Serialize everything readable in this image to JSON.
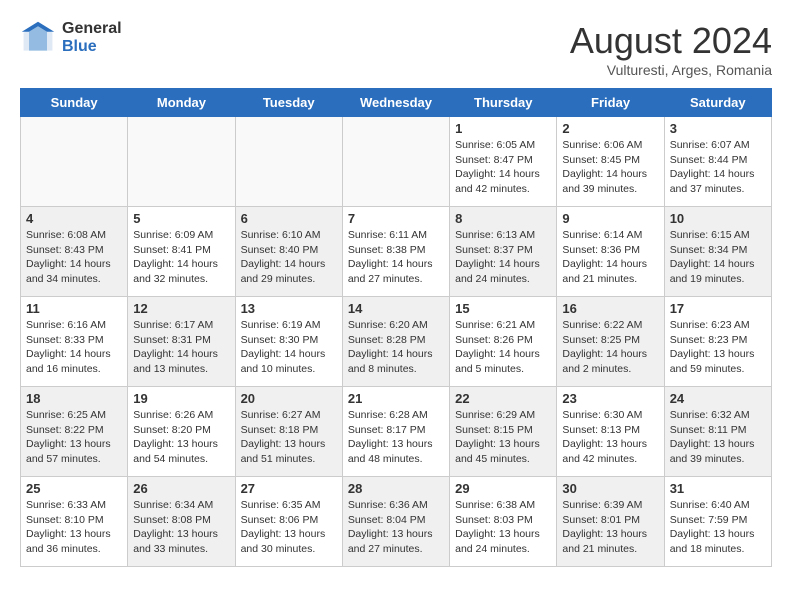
{
  "header": {
    "logo_general": "General",
    "logo_blue": "Blue",
    "month_title": "August 2024",
    "subtitle": "Vulturesti, Arges, Romania"
  },
  "days_of_week": [
    "Sunday",
    "Monday",
    "Tuesday",
    "Wednesday",
    "Thursday",
    "Friday",
    "Saturday"
  ],
  "weeks": [
    [
      {
        "day": "",
        "empty": true
      },
      {
        "day": "",
        "empty": true
      },
      {
        "day": "",
        "empty": true
      },
      {
        "day": "",
        "empty": true
      },
      {
        "day": "1",
        "info": "Sunrise: 6:05 AM\nSunset: 8:47 PM\nDaylight: 14 hours\nand 42 minutes."
      },
      {
        "day": "2",
        "info": "Sunrise: 6:06 AM\nSunset: 8:45 PM\nDaylight: 14 hours\nand 39 minutes."
      },
      {
        "day": "3",
        "info": "Sunrise: 6:07 AM\nSunset: 8:44 PM\nDaylight: 14 hours\nand 37 minutes."
      }
    ],
    [
      {
        "day": "4",
        "info": "Sunrise: 6:08 AM\nSunset: 8:43 PM\nDaylight: 14 hours\nand 34 minutes.",
        "shaded": true
      },
      {
        "day": "5",
        "info": "Sunrise: 6:09 AM\nSunset: 8:41 PM\nDaylight: 14 hours\nand 32 minutes."
      },
      {
        "day": "6",
        "info": "Sunrise: 6:10 AM\nSunset: 8:40 PM\nDaylight: 14 hours\nand 29 minutes.",
        "shaded": true
      },
      {
        "day": "7",
        "info": "Sunrise: 6:11 AM\nSunset: 8:38 PM\nDaylight: 14 hours\nand 27 minutes."
      },
      {
        "day": "8",
        "info": "Sunrise: 6:13 AM\nSunset: 8:37 PM\nDaylight: 14 hours\nand 24 minutes.",
        "shaded": true
      },
      {
        "day": "9",
        "info": "Sunrise: 6:14 AM\nSunset: 8:36 PM\nDaylight: 14 hours\nand 21 minutes."
      },
      {
        "day": "10",
        "info": "Sunrise: 6:15 AM\nSunset: 8:34 PM\nDaylight: 14 hours\nand 19 minutes.",
        "shaded": true
      }
    ],
    [
      {
        "day": "11",
        "info": "Sunrise: 6:16 AM\nSunset: 8:33 PM\nDaylight: 14 hours\nand 16 minutes."
      },
      {
        "day": "12",
        "info": "Sunrise: 6:17 AM\nSunset: 8:31 PM\nDaylight: 14 hours\nand 13 minutes.",
        "shaded": true
      },
      {
        "day": "13",
        "info": "Sunrise: 6:19 AM\nSunset: 8:30 PM\nDaylight: 14 hours\nand 10 minutes."
      },
      {
        "day": "14",
        "info": "Sunrise: 6:20 AM\nSunset: 8:28 PM\nDaylight: 14 hours\nand 8 minutes.",
        "shaded": true
      },
      {
        "day": "15",
        "info": "Sunrise: 6:21 AM\nSunset: 8:26 PM\nDaylight: 14 hours\nand 5 minutes."
      },
      {
        "day": "16",
        "info": "Sunrise: 6:22 AM\nSunset: 8:25 PM\nDaylight: 14 hours\nand 2 minutes.",
        "shaded": true
      },
      {
        "day": "17",
        "info": "Sunrise: 6:23 AM\nSunset: 8:23 PM\nDaylight: 13 hours\nand 59 minutes."
      }
    ],
    [
      {
        "day": "18",
        "info": "Sunrise: 6:25 AM\nSunset: 8:22 PM\nDaylight: 13 hours\nand 57 minutes.",
        "shaded": true
      },
      {
        "day": "19",
        "info": "Sunrise: 6:26 AM\nSunset: 8:20 PM\nDaylight: 13 hours\nand 54 minutes."
      },
      {
        "day": "20",
        "info": "Sunrise: 6:27 AM\nSunset: 8:18 PM\nDaylight: 13 hours\nand 51 minutes.",
        "shaded": true
      },
      {
        "day": "21",
        "info": "Sunrise: 6:28 AM\nSunset: 8:17 PM\nDaylight: 13 hours\nand 48 minutes."
      },
      {
        "day": "22",
        "info": "Sunrise: 6:29 AM\nSunset: 8:15 PM\nDaylight: 13 hours\nand 45 minutes.",
        "shaded": true
      },
      {
        "day": "23",
        "info": "Sunrise: 6:30 AM\nSunset: 8:13 PM\nDaylight: 13 hours\nand 42 minutes."
      },
      {
        "day": "24",
        "info": "Sunrise: 6:32 AM\nSunset: 8:11 PM\nDaylight: 13 hours\nand 39 minutes.",
        "shaded": true
      }
    ],
    [
      {
        "day": "25",
        "info": "Sunrise: 6:33 AM\nSunset: 8:10 PM\nDaylight: 13 hours\nand 36 minutes."
      },
      {
        "day": "26",
        "info": "Sunrise: 6:34 AM\nSunset: 8:08 PM\nDaylight: 13 hours\nand 33 minutes.",
        "shaded": true
      },
      {
        "day": "27",
        "info": "Sunrise: 6:35 AM\nSunset: 8:06 PM\nDaylight: 13 hours\nand 30 minutes."
      },
      {
        "day": "28",
        "info": "Sunrise: 6:36 AM\nSunset: 8:04 PM\nDaylight: 13 hours\nand 27 minutes.",
        "shaded": true
      },
      {
        "day": "29",
        "info": "Sunrise: 6:38 AM\nSunset: 8:03 PM\nDaylight: 13 hours\nand 24 minutes."
      },
      {
        "day": "30",
        "info": "Sunrise: 6:39 AM\nSunset: 8:01 PM\nDaylight: 13 hours\nand 21 minutes.",
        "shaded": true
      },
      {
        "day": "31",
        "info": "Sunrise: 6:40 AM\nSunset: 7:59 PM\nDaylight: 13 hours\nand 18 minutes."
      }
    ]
  ]
}
